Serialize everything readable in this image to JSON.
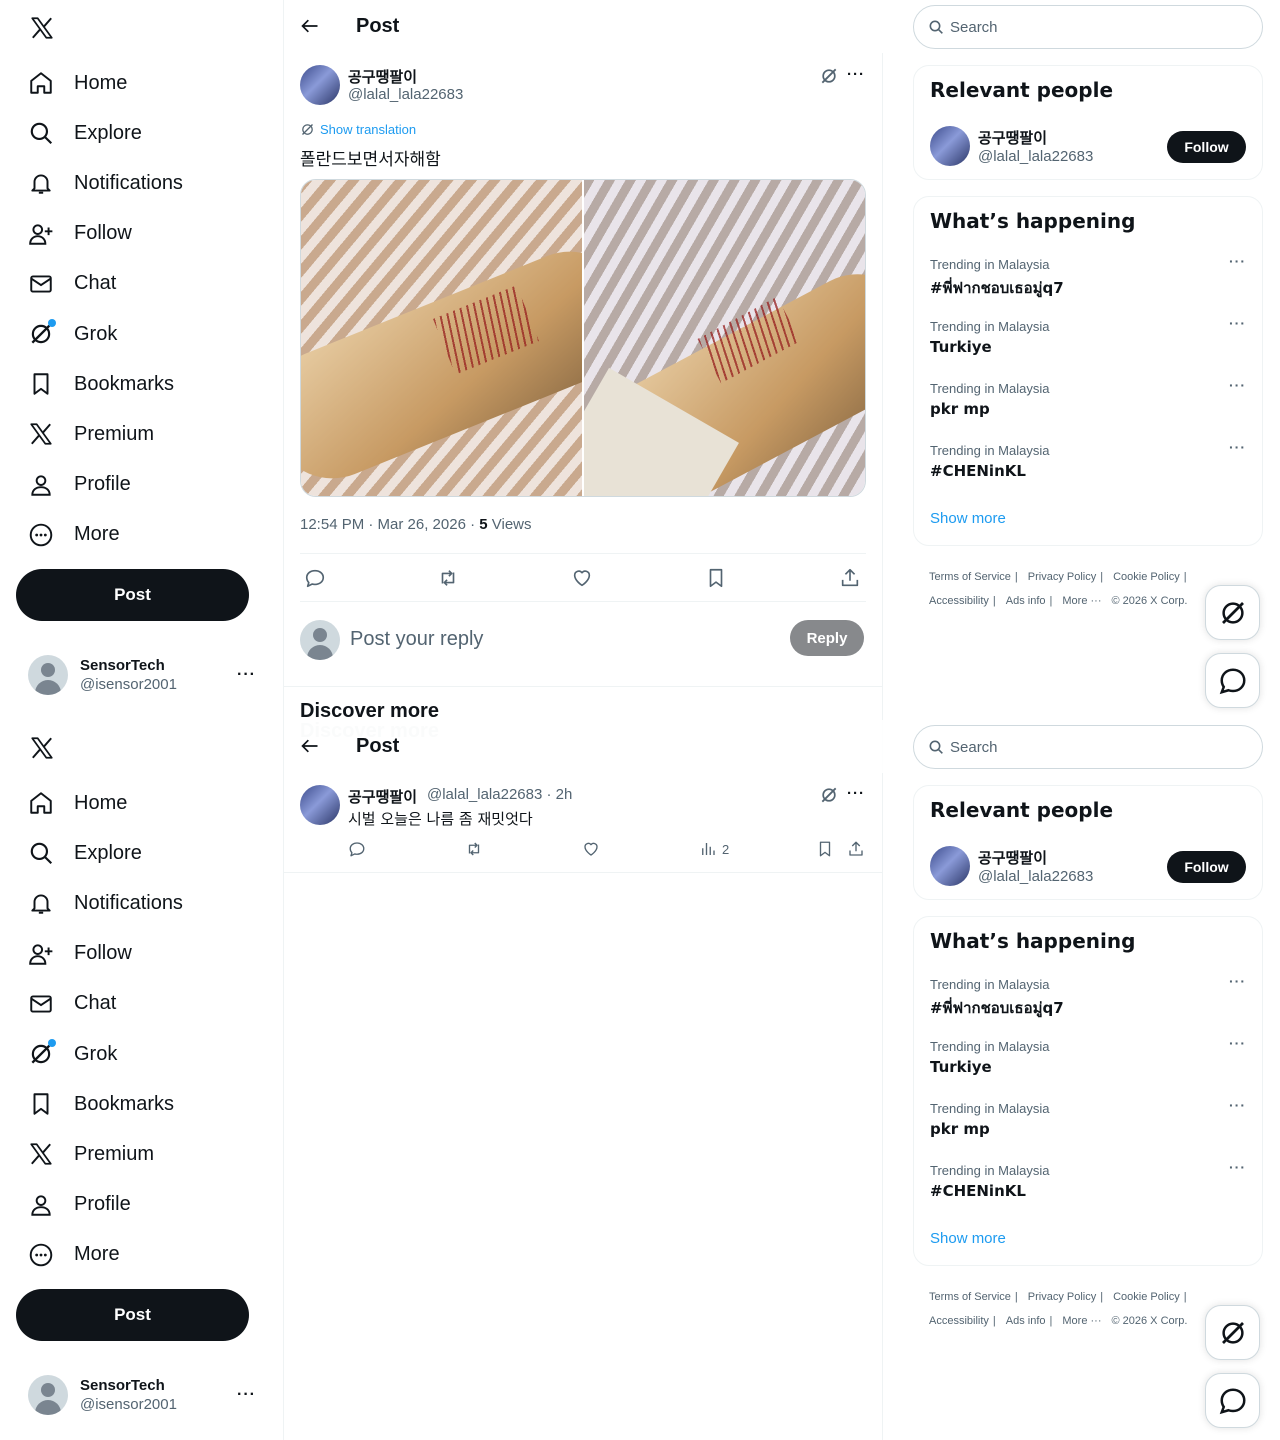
{
  "nav": {
    "items": [
      {
        "label": "Home",
        "icon": "home-icon"
      },
      {
        "label": "Explore",
        "icon": "search-icon"
      },
      {
        "label": "Notifications",
        "icon": "bell-icon"
      },
      {
        "label": "Follow",
        "icon": "person-add-icon"
      },
      {
        "label": "Chat",
        "icon": "envelope-icon"
      },
      {
        "label": "Grok",
        "icon": "grok-icon"
      },
      {
        "label": "Bookmarks",
        "icon": "bookmark-icon"
      },
      {
        "label": "Premium",
        "icon": "x-logo-icon"
      },
      {
        "label": "Profile",
        "icon": "person-icon"
      },
      {
        "label": "More",
        "icon": "more-circle-icon"
      }
    ],
    "post_button": "Post"
  },
  "account": {
    "name": "SensorTech",
    "handle": "@isensor2001",
    "more": "···"
  },
  "main": {
    "title": "Post",
    "author": {
      "name": "공구땡팔이",
      "handle": "@lalal_lala22683"
    },
    "more": "···",
    "show_translation": "Show translation",
    "text": "폴란드보면서자해함",
    "timestamp": "12:54 PM · Mar 26, 2026 · ",
    "views_count": "5",
    "views_label": " Views",
    "reply_placeholder": "Post your reply",
    "reply_button": "Reply",
    "discover_more": "Discover more"
  },
  "discover_tweet": {
    "name": "공구땡팔이",
    "meta": "@lalal_lala22683 · 2h",
    "text": "시벌 오늘은 나름 좀 재밋엇다",
    "views": "2"
  },
  "sidebar": {
    "search_placeholder": "Search",
    "relevant_title": "Relevant people",
    "person": {
      "name": "공구땡팔이",
      "handle": "@lalal_lala22683",
      "follow": "Follow"
    },
    "happening_title": "What’s happening",
    "trends": [
      {
        "context": "Trending in Malaysia",
        "name": "#พี่ฟากชอบเธอมู่q7"
      },
      {
        "context": "Trending in Malaysia",
        "name": "Turkiye"
      },
      {
        "context": "Trending in Malaysia",
        "name": "pkr mp"
      },
      {
        "context": "Trending in Malaysia",
        "name": "#CHENinKL"
      }
    ],
    "trend_more": "···",
    "show_more": "Show more",
    "footer": {
      "terms": "Terms of Service",
      "privacy": "Privacy Policy",
      "cookie": "Cookie Policy",
      "accessibility": "Accessibility",
      "ads": "Ads info",
      "more": "More ···",
      "copyright": "© 2026 X Corp.",
      "sep": "|"
    }
  },
  "colors": {
    "accent": "#1d9bf0",
    "text": "#0f1419",
    "muted": "#536471",
    "border": "#eff3f4"
  }
}
